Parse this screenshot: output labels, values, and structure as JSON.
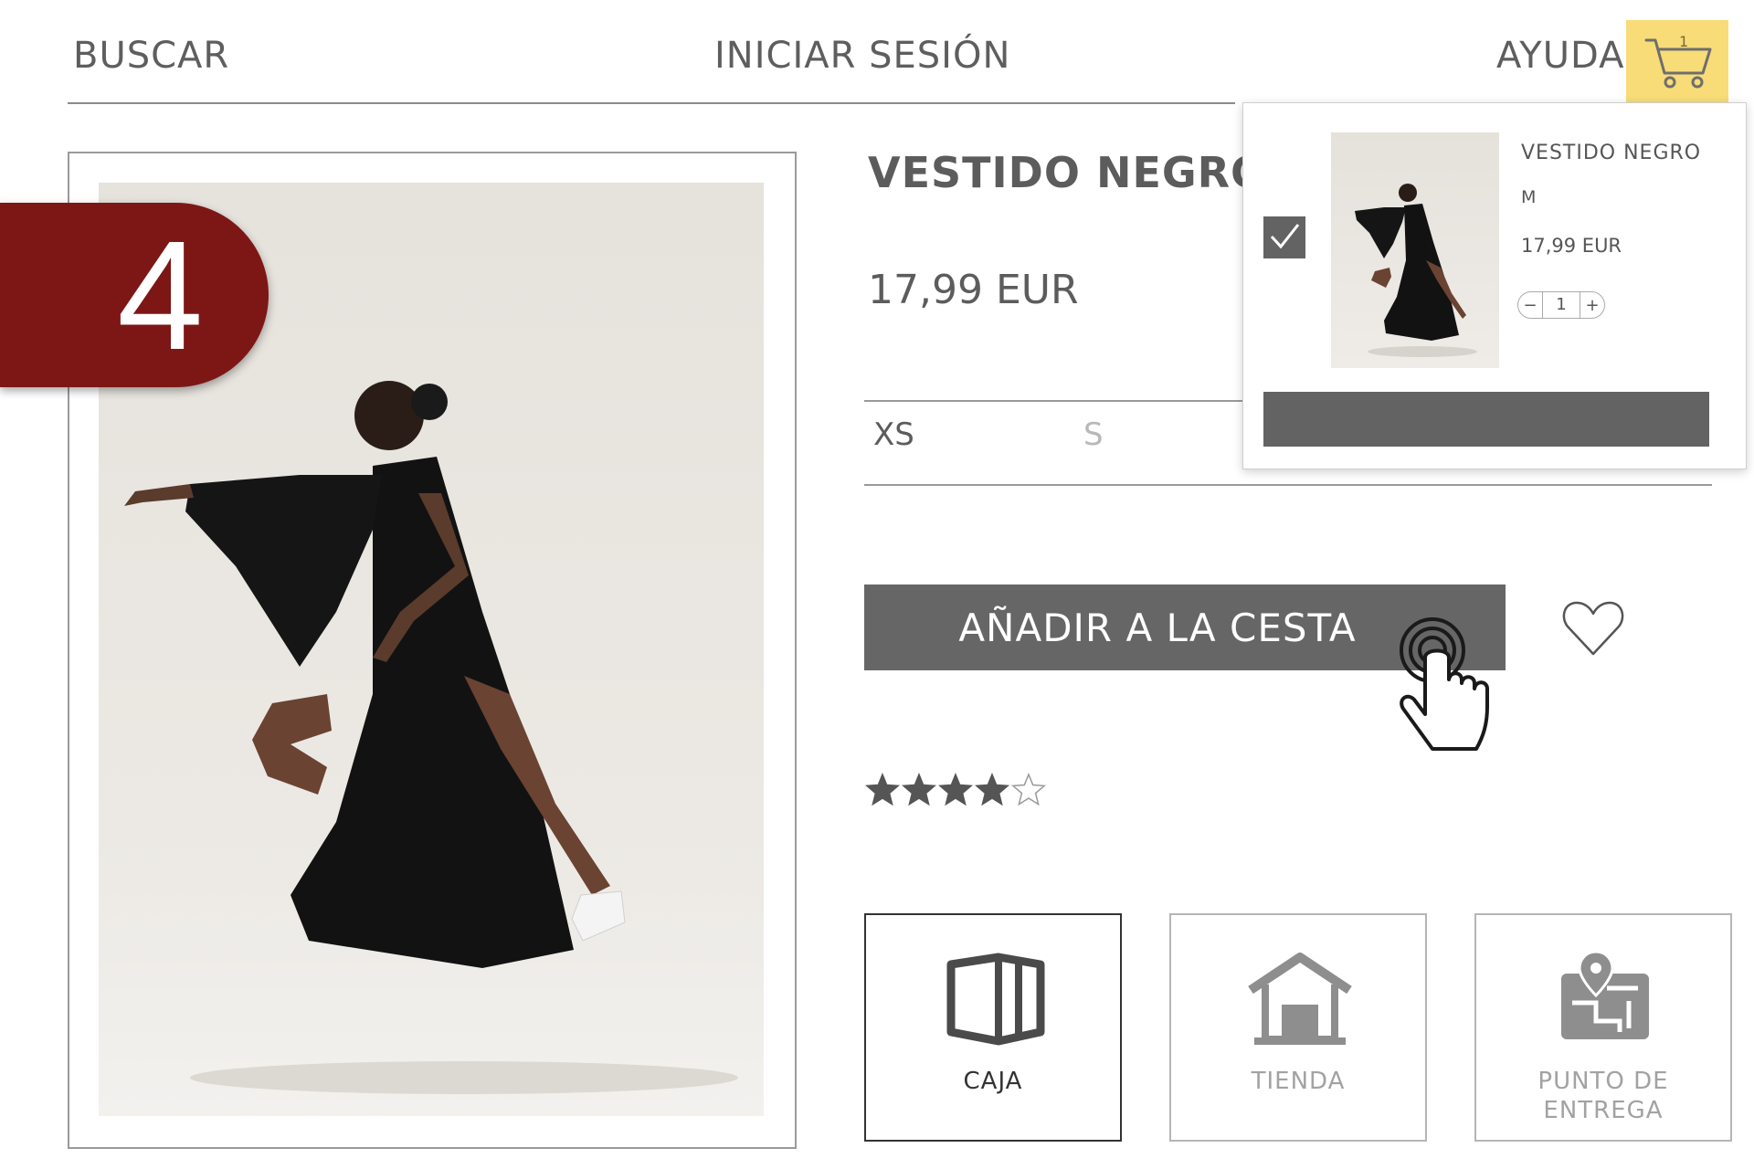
{
  "header": {
    "search_label": "BUSCAR",
    "login_label": "INICIAR SESIÓN",
    "help_label": "AYUDA",
    "cart_count": "1",
    "cart_icon": "shopping-cart-icon",
    "cart_button_color": "#f7dc77"
  },
  "step": {
    "number": "4",
    "badge_color": "#7d1716"
  },
  "product": {
    "title": "VESTIDO NEGRO",
    "price": "17,99 EUR",
    "sizes": [
      "XS",
      "S"
    ],
    "selected_size": "XS",
    "add_to_cart_label": "AÑADIR A LA CESTA",
    "button_color": "#666666",
    "wishlist_icon": "heart-outline-icon",
    "rating": 4,
    "rating_max": 5
  },
  "delivery_options": [
    {
      "label": "CAJA",
      "icon": "box-icon",
      "selected": true
    },
    {
      "label": "TIENDA",
      "icon": "store-icon",
      "selected": false
    },
    {
      "label": "PUNTO DE ENTREGA",
      "icon": "map-pin-icon",
      "selected": false
    }
  ],
  "mini_cart": {
    "item_name": "VESTIDO NEGRO",
    "item_size": "M",
    "item_price": "17,99 EUR",
    "quantity": "1",
    "minus_label": "−",
    "plus_label": "+",
    "checked": true
  }
}
